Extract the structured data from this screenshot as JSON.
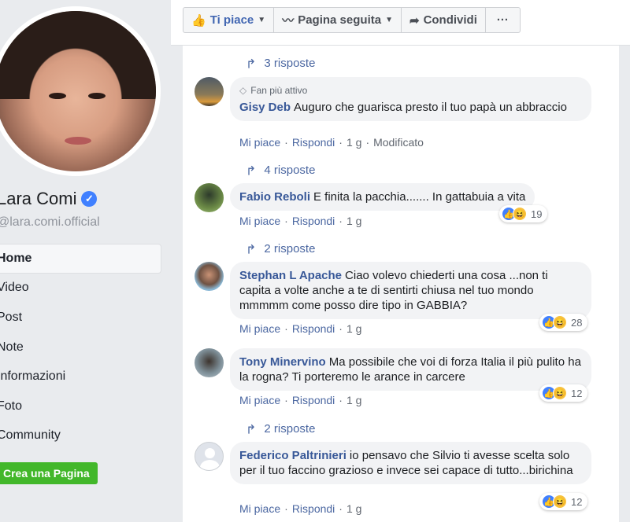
{
  "page": {
    "name": "Lara Comi",
    "handle": "@lara.comi.official"
  },
  "nav": {
    "items": [
      {
        "label": "Home"
      },
      {
        "label": "Video"
      },
      {
        "label": "Post"
      },
      {
        "label": "Note"
      },
      {
        "label": "Informazioni"
      },
      {
        "label": "Foto"
      },
      {
        "label": "Community"
      }
    ],
    "create_page": "Crea una Pagina"
  },
  "actions": {
    "like": "Ti piace",
    "follow": "Pagina seguita",
    "share": "Condividi",
    "more": "···"
  },
  "replies": {
    "r0": "3 risposte",
    "r1": "4 risposte",
    "r2": "2 risposte",
    "r3": "2 risposte"
  },
  "labels": {
    "like": "Mi piace",
    "reply": "Rispondi",
    "dot": "·"
  },
  "comments": [
    {
      "badge": "Fan più attivo",
      "author": "Gisy Deb",
      "text": "Auguro che guarisca presto il tuo papà un abbraccio",
      "time": "1 g",
      "edited": "Modificato"
    },
    {
      "author": "Fabio Reboli",
      "text": "E finita la pacchia....... In gattabuia a vita",
      "time": "1 g",
      "reactions": "19"
    },
    {
      "author": "Stephan L Apache",
      "text": "Ciao volevo chiederti una cosa ...non ti capita a volte anche a te di sentirti chiusa nel tuo mondo mmmmm come posso dire tipo in GABBIA?",
      "time": "1 g",
      "reactions": "28"
    },
    {
      "author": "Tony Minervino",
      "text": "Ma possibile che voi di forza Italia il più pulito ha la rogna? Ti porteremo le arance in carcere",
      "time": "1 g",
      "reactions": "12"
    },
    {
      "author": "Federico Paltrinieri",
      "text": "io pensavo che Silvio ti avesse scelta solo per il tuo faccino grazioso e invece sei capace di tutto...birichina",
      "time": "1 g",
      "reactions": "12"
    }
  ],
  "colors": {
    "link": "#385898",
    "green_button": "#42b72a",
    "like_blue": "#4080ff"
  }
}
